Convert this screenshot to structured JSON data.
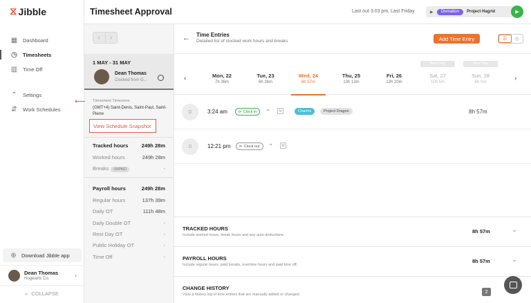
{
  "sidebar": {
    "logo": "Jibble",
    "items": [
      {
        "label": "Dashboard",
        "icon": "dashboard-icon"
      },
      {
        "label": "Timesheets",
        "icon": "clock-icon"
      },
      {
        "label": "Time Off",
        "icon": "calendar-icon"
      },
      {
        "label": "Settings",
        "icon": "settings-icon"
      },
      {
        "label": "Work Schedules",
        "icon": "schedule-icon"
      }
    ],
    "download": "Download Jibble app",
    "user": {
      "name": "Dean Thomas",
      "org": "Hogwarts Co."
    },
    "collapse": "COLLAPSE"
  },
  "header": {
    "title": "Timesheet Approval",
    "last_out": "Last out 3:03 pm, Last Friday",
    "activity": "Divination",
    "project": "Project Hagrid"
  },
  "left_panel": {
    "period": "1 MAY - 31 MAY",
    "employee": {
      "name": "Dean Thomas",
      "status": "Clocked from G..."
    },
    "timezone_label": "Timesheet Timezone",
    "timezone_value": "(GMT+4) Saint-Denis, Saint-Paul, Saint-Pierre",
    "snapshot_link": "View Schedule Snapshot",
    "tracked": {
      "label": "Tracked hours",
      "value": "249h 28m"
    },
    "worked": {
      "label": "Worked hours",
      "value": "249h 28m"
    },
    "breaks": {
      "label": "Breaks",
      "badge": "UNPAID",
      "value": "-"
    },
    "payroll": {
      "label": "Payroll hours",
      "value": "249h 28m"
    },
    "regular": {
      "label": "Regular hours",
      "value": "137h 39m"
    },
    "daily_ot": {
      "label": "Daily OT",
      "value": "111h 48m"
    },
    "daily_double_ot": {
      "label": "Daily Double OT",
      "value": "-"
    },
    "rest_day_ot": {
      "label": "Rest Day OT",
      "value": "-"
    },
    "public_holiday_ot": {
      "label": "Public Holiday OT",
      "value": "-"
    },
    "time_off": {
      "label": "Time Off",
      "value": "-"
    }
  },
  "main": {
    "title": "Time Entries",
    "subtitle": "Detailed list of clocked work hours and breaks",
    "add_button": "Add Time Entry",
    "days": [
      {
        "name": "Mon, 22",
        "hours": "7h 36m"
      },
      {
        "name": "Tue, 23",
        "hours": "6h 26m"
      },
      {
        "name": "Wed, 24",
        "hours": "8h 57m"
      },
      {
        "name": "Thu, 25",
        "hours": "13h 13m"
      },
      {
        "name": "Fri, 26",
        "hours": "13h 20m"
      },
      {
        "name": "Sat, 27",
        "hours": "10h 5m",
        "tag": "Rest Day"
      },
      {
        "name": "Sun, 28",
        "hours": "6h 0m",
        "tag": "Rest Day"
      }
    ],
    "entries": [
      {
        "initial": "D",
        "time": "3:24 am",
        "chip": "Clock in",
        "activity": "Charms",
        "project": "Project Dragon",
        "duration": "8h 57m"
      },
      {
        "initial": "D",
        "time": "12:21 pm",
        "chip": "Clock out"
      }
    ],
    "summary": [
      {
        "title": "TRACKED HOURS",
        "sub": "Include worked hours, break hours and any auto deductions.",
        "value": "8h 57m"
      },
      {
        "title": "PAYROLL HOURS",
        "sub": "Include regular hours, paid breaks, overtime hours and paid time off.",
        "value": "8h 57m"
      },
      {
        "title": "CHANGE HISTORY",
        "sub": "View a history log of time entries that are manually added or changed.",
        "value": "2"
      }
    ]
  },
  "colors": {
    "accent": "#e8742f",
    "green": "#38b54a",
    "purple": "#7b63e8",
    "cyan": "#4dbfd6"
  }
}
